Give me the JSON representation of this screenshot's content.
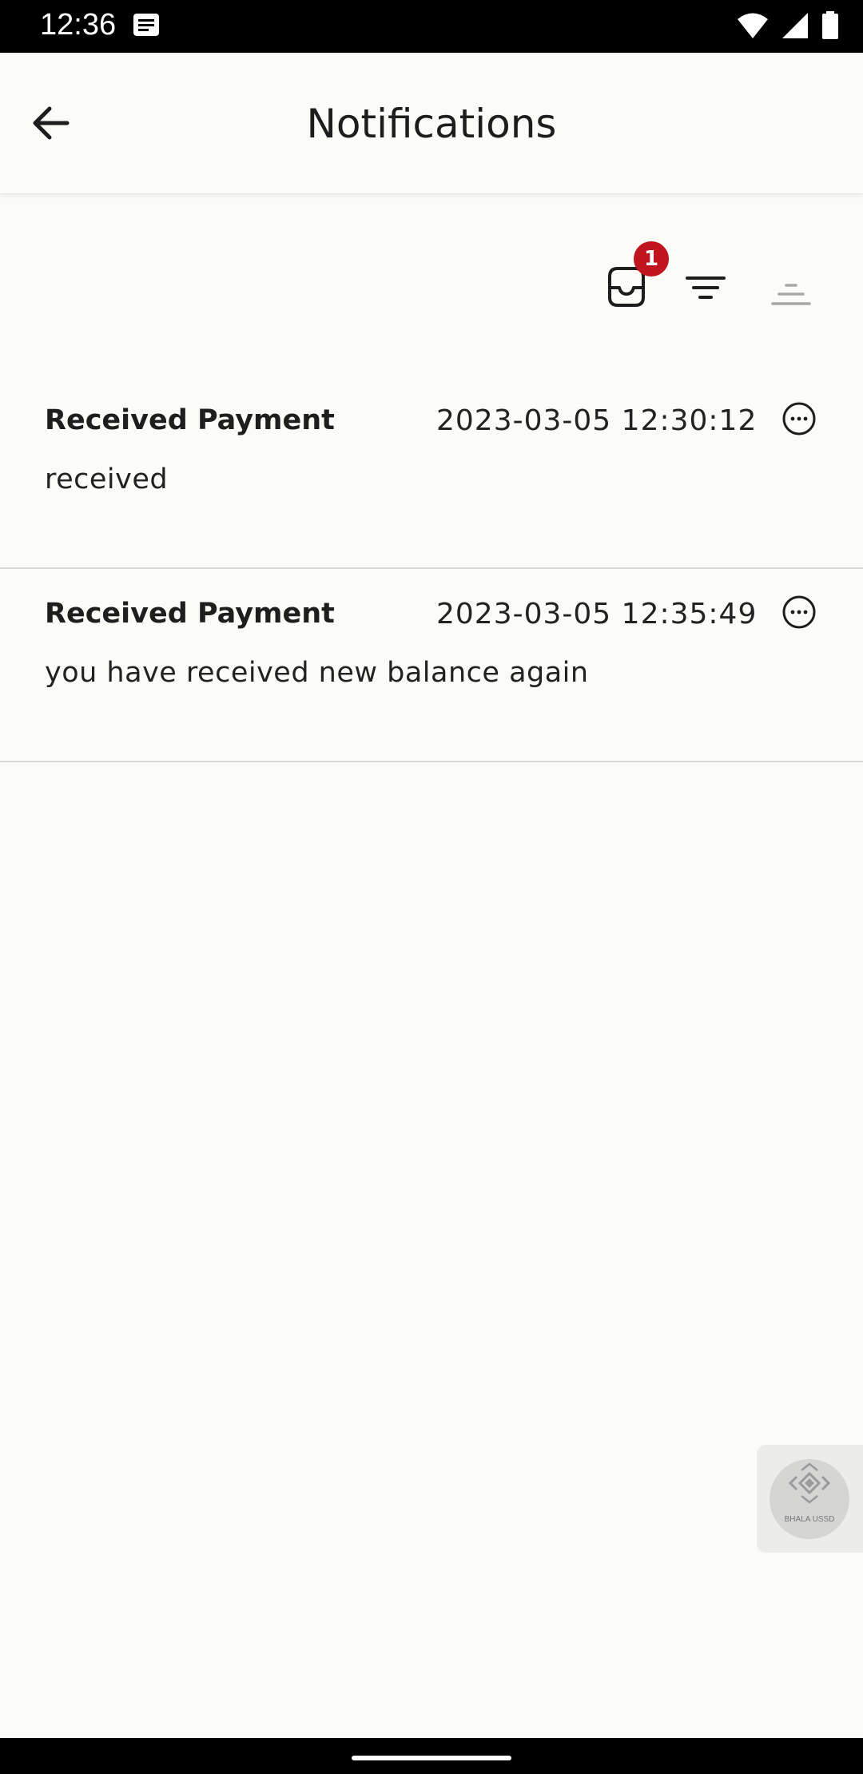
{
  "status_bar": {
    "time": "12:36",
    "icons": [
      "notification-note-icon",
      "wifi-icon",
      "signal-icon",
      "battery-icon"
    ]
  },
  "header": {
    "title": "Notifications",
    "back_icon": "arrow-left-icon"
  },
  "toolbar": {
    "inbox_icon": "inbox-icon",
    "inbox_badge": "1",
    "filter_icon": "filter-icon",
    "sort_icon": "sort-lines-icon"
  },
  "notifications": [
    {
      "title": "Received Payment",
      "time": "2023-03-05 12:30:12",
      "body": "received",
      "more_icon": "more-horizontal-circle-icon"
    },
    {
      "title": "Received Payment",
      "time": "2023-03-05 12:35:49",
      "body": "you have received new balance again",
      "more_icon": "more-horizontal-circle-icon"
    }
  ],
  "floating_widget": {
    "label": "BHALA USSD"
  },
  "colors": {
    "background": "#fbfcf8",
    "badge": "#c0151e",
    "text": "#1d1d1d",
    "divider": "#d9d9d9"
  }
}
